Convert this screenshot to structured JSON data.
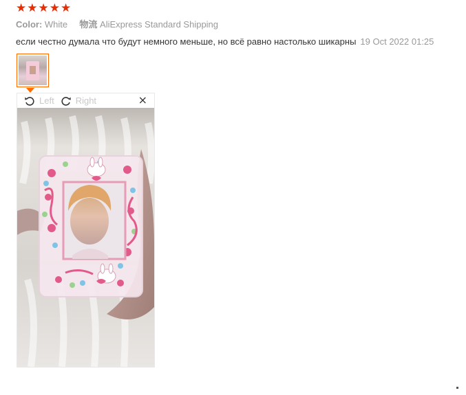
{
  "rating": {
    "stars": 5,
    "star_glyph": "★",
    "color": "#e62e04"
  },
  "meta": {
    "color_label": "Color:",
    "color_value": "White",
    "shipping_label": "物流",
    "shipping_value": "AliExpress Standard Shipping"
  },
  "review": {
    "text": "если честно думала что будут немного меньше, но всё равно настолько шикарны",
    "date": "19 Oct 2022 01:25"
  },
  "viewer": {
    "rotate_left_label": "Left",
    "rotate_right_label": "Right",
    "close_glyph": "×",
    "icons": [
      "rotate-left-icon",
      "rotate-right-icon",
      "close-icon"
    ]
  },
  "photo": {
    "description_colors": {
      "background": "#e8e4e0",
      "card_frame": "#f2cad8",
      "accent": "#ff6a00"
    }
  }
}
